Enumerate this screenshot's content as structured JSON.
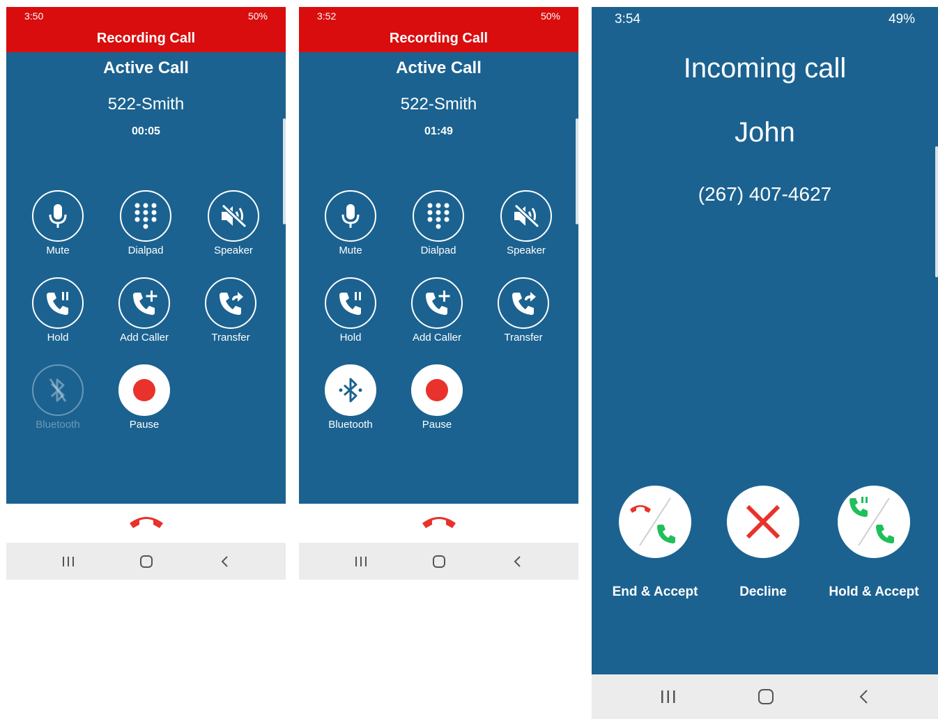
{
  "screens": [
    {
      "status": {
        "time": "3:50",
        "right": "50%"
      },
      "banner": "Recording Call",
      "title": "Active Call",
      "caller": "522-Smith",
      "timer": "00:05",
      "buttons": {
        "mute": "Mute",
        "dialpad": "Dialpad",
        "speaker": "Speaker",
        "hold": "Hold",
        "add_caller": "Add Caller",
        "transfer": "Transfer",
        "bluetooth": "Bluetooth",
        "pause": "Pause"
      },
      "bluetooth_enabled": false
    },
    {
      "status": {
        "time": "3:52",
        "right": "50%"
      },
      "banner": "Recording Call",
      "title": "Active Call",
      "caller": "522-Smith",
      "timer": "01:49",
      "buttons": {
        "mute": "Mute",
        "dialpad": "Dialpad",
        "speaker": "Speaker",
        "hold": "Hold",
        "add_caller": "Add Caller",
        "transfer": "Transfer",
        "bluetooth": "Bluetooth",
        "pause": "Pause"
      },
      "bluetooth_enabled": true
    },
    {
      "status": {
        "time": "3:54",
        "right": "49%"
      },
      "title": "Incoming call",
      "caller_name": "John",
      "caller_number": "(267) 407-4627",
      "actions": {
        "end_accept": "End & Accept",
        "decline": "Decline",
        "hold_accept": "Hold & Accept"
      }
    }
  ],
  "colors": {
    "background": "#1b6290",
    "banner": "#d90d0d",
    "record": "#e8322b",
    "accept": "#1fbf5a"
  },
  "icons": [
    "microphone-icon",
    "dialpad-icon",
    "speaker-muted-icon",
    "phone-hold-icon",
    "phone-add-icon",
    "phone-transfer-icon",
    "bluetooth-icon",
    "record-icon",
    "hangup-icon",
    "recents-icon",
    "home-icon",
    "back-icon",
    "close-icon"
  ]
}
